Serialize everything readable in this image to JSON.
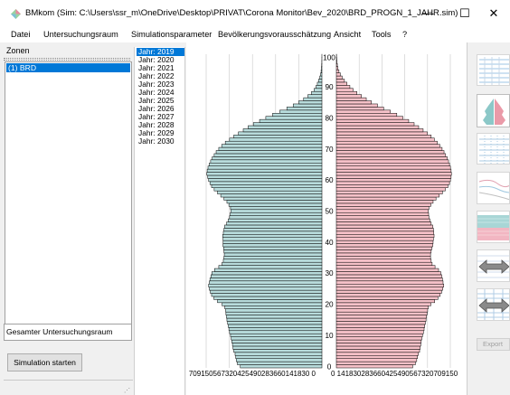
{
  "window": {
    "title": "BMkom (Sim: C:\\Users\\ssr_m\\OneDrive\\Desktop\\PRIVAT\\Corona Monitor\\Bev_2020\\BRD_PROGN_1_JAHR.sim)",
    "minimize_glyph": "—",
    "maximize_glyph": "☐",
    "close_glyph": "✕"
  },
  "menu": [
    "Datei",
    "Untersuchungsraum",
    "Simulationsparameter",
    "Bevölkerungsvorausschätzung",
    "Ansicht",
    "Tools",
    "?"
  ],
  "zones": {
    "label": "Zonen",
    "items": [
      "(1) BRD"
    ],
    "selected_index": 0
  },
  "total_area_label": "Gesamter Untersuchungsraum",
  "simulate_button": "Simulation starten",
  "years": {
    "items": [
      "Jahr: 2019",
      "Jahr: 2020",
      "Jahr: 2021",
      "Jahr: 2022",
      "Jahr: 2023",
      "Jahr: 2024",
      "Jahr: 2025",
      "Jahr: 2026",
      "Jahr: 2027",
      "Jahr: 2028",
      "Jahr: 2029",
      "Jahr: 2030"
    ],
    "selected_index": 0
  },
  "right_panel": {
    "export_label": "Export",
    "thumbnails": [
      "population-table-icon",
      "population-pyramid-icon",
      "grid-table-icon",
      "line-chart-icon",
      "area-chart-icon",
      "compare-arrows-icon",
      "compare-arrows-grid-icon"
    ]
  },
  "colors": {
    "male": "#b8dcdc",
    "female": "#f6c1c8",
    "bar_outline": "#000000",
    "selection": "#0078d7"
  },
  "chart_data": {
    "type": "bar",
    "orientation": "horizontal-pyramid",
    "age_labels": [
      "100",
      "90",
      "80",
      "70",
      "60",
      "50",
      "40",
      "30",
      "20",
      "10",
      "0"
    ],
    "age_range": [
      0,
      100
    ],
    "x_max": 709150,
    "left_axis_tick_text": "709150567320425490283660141830    0",
    "right_axis_tick_text": "0    141830283660425490567320709150",
    "series": [
      {
        "side": "left",
        "values": [
          500000,
          518000,
          525000,
          528000,
          532000,
          540000,
          545000,
          548000,
          552000,
          556000,
          560000,
          566000,
          570000,
          574000,
          578000,
          582000,
          585000,
          588000,
          590000,
          595000,
          612000,
          640000,
          662000,
          676000,
          684000,
          690000,
          694000,
          690000,
          686000,
          680000,
          674000,
          658000,
          632000,
          612000,
          604000,
          600000,
          598000,
          600000,
          602000,
          606000,
          605000,
          606000,
          608000,
          604000,
          600000,
          596000,
          584000,
          574000,
          566000,
          562000,
          558000,
          560000,
          570000,
          582000,
          600000,
          620000,
          640000,
          660000,
          676000,
          686000,
          694000,
          700000,
          705000,
          703000,
          698000,
          690000,
          682000,
          672000,
          660000,
          648000,
          632000,
          614000,
          592000,
          566000,
          540000,
          512000,
          482000,
          452000,
          420000,
          382000,
          344000,
          302000,
          258000,
          215000,
          176000,
          142000,
          112000,
          86000,
          64000,
          48000,
          36000,
          28000,
          20000,
          13000,
          8000,
          5000,
          3000,
          1500,
          800,
          400,
          200
        ]
      },
      {
        "side": "right",
        "values": [
          475000,
          492000,
          500000,
          505000,
          510000,
          518000,
          522000,
          525000,
          528000,
          532000,
          536000,
          542000,
          546000,
          550000,
          554000,
          558000,
          561000,
          564000,
          568000,
          572000,
          588000,
          612000,
          632000,
          646000,
          655000,
          662000,
          668000,
          664000,
          660000,
          656000,
          650000,
          636000,
          614000,
          596000,
          590000,
          586000,
          586000,
          590000,
          594000,
          600000,
          602000,
          604000,
          608000,
          606000,
          604000,
          600000,
          590000,
          582000,
          576000,
          574000,
          572000,
          576000,
          588000,
          602000,
          620000,
          640000,
          660000,
          678000,
          694000,
          704000,
          710000,
          714000,
          716000,
          714000,
          710000,
          704000,
          698000,
          690000,
          680000,
          670000,
          658000,
          644000,
          628000,
          610000,
          590000,
          566000,
          540000,
          512000,
          484000,
          450000,
          414000,
          376000,
          336000,
          294000,
          256000,
          218000,
          186000,
          156000,
          128000,
          104000,
          84000,
          66000,
          50000,
          36000,
          25000,
          16000,
          10000,
          6000,
          3500,
          2000,
          1000
        ]
      }
    ]
  }
}
